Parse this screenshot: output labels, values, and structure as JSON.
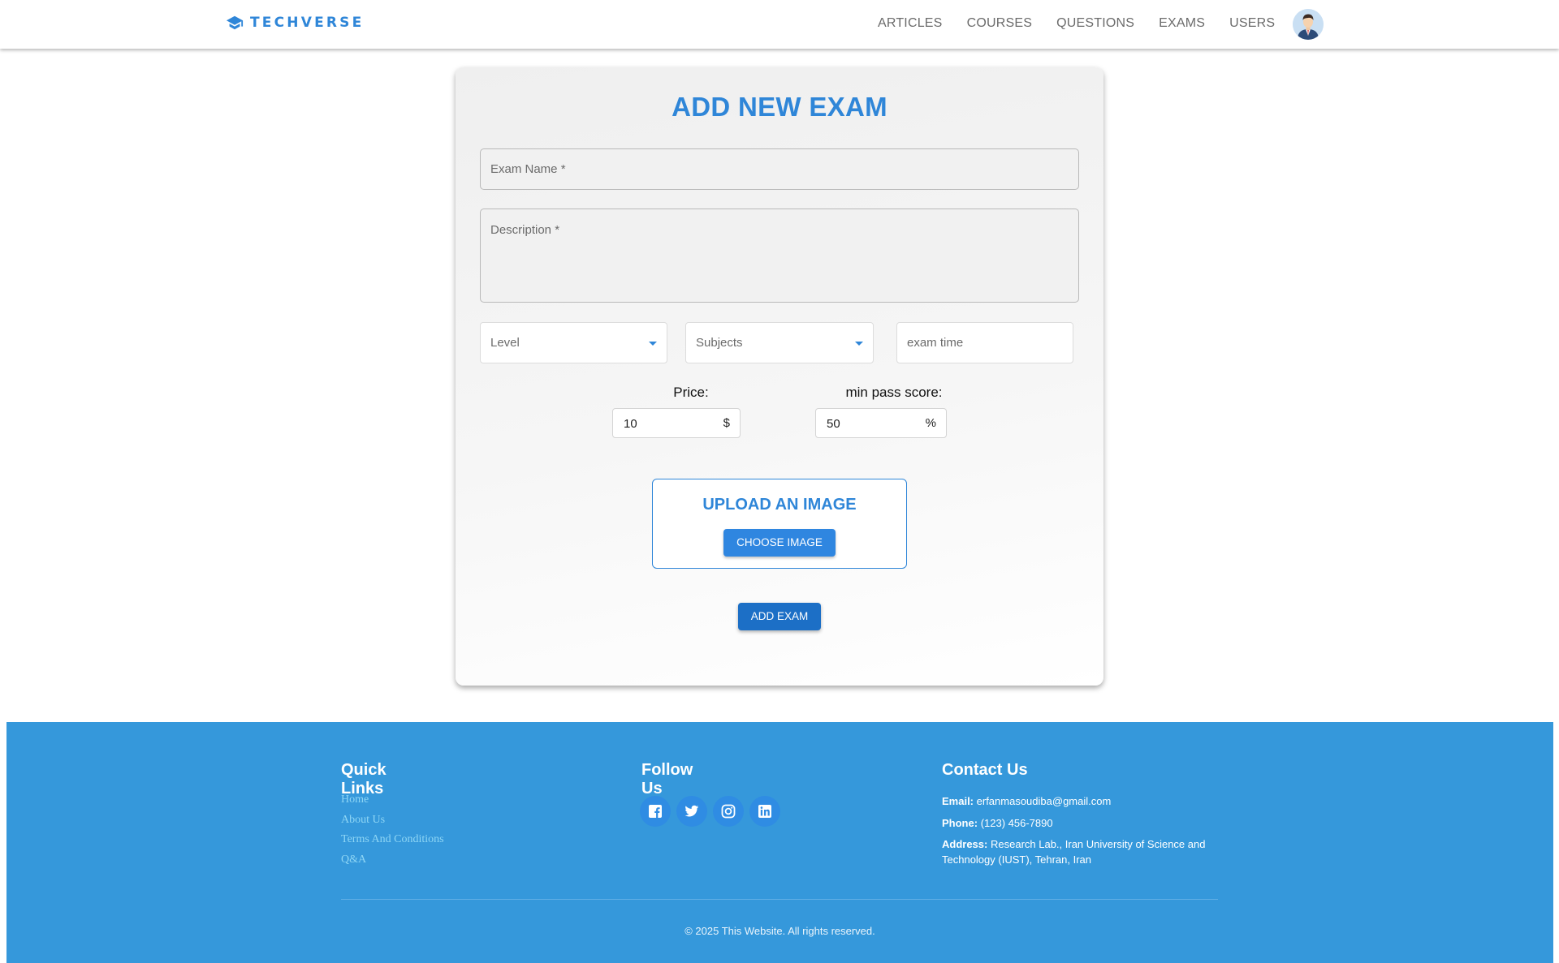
{
  "header": {
    "brand": "TECHVERSE",
    "nav": [
      "ARTICLES",
      "COURSES",
      "QUESTIONS",
      "EXAMS",
      "USERS"
    ],
    "brand_icon": "graduation-cap-icon",
    "avatar_icon": "user-avatar"
  },
  "form": {
    "title": "ADD NEW EXAM",
    "exam_name_label": "Exam Name *",
    "description_label": "Description *",
    "level_label": "Level",
    "subjects_label": "Subjects",
    "exam_time_placeholder": "exam time",
    "price_label": "Price:",
    "price_value": "10",
    "price_unit": "$",
    "min_pass_label": "min pass score:",
    "min_pass_value": "50",
    "min_pass_unit": "%",
    "upload_title": "UPLOAD AN IMAGE",
    "choose_image_label": "CHOOSE IMAGE",
    "add_exam_label": "ADD EXAM"
  },
  "footer": {
    "quick_links_title": "Quick Links",
    "quick_links": [
      "Home",
      "About Us",
      "Terms And Conditions",
      "Q&A"
    ],
    "follow_title": "Follow Us",
    "social_icons": [
      "facebook-icon",
      "twitter-icon",
      "instagram-icon",
      "linkedin-icon"
    ],
    "contact_title": "Contact Us",
    "email_label": "Email:",
    "email_value": "erfanmasoudiba@gmail.com",
    "phone_label": "Phone:",
    "phone_value": "(123) 456-7890",
    "address_label": "Address:",
    "address_value": "Research Lab., Iran University of Science and Technology (IUST), Tehran, Iran",
    "copyright": "© 2025 This Website. All rights reserved."
  },
  "colors": {
    "accent": "#2f86d8",
    "footer_bg": "#3598db",
    "primary_button": "#1c6fc6"
  }
}
